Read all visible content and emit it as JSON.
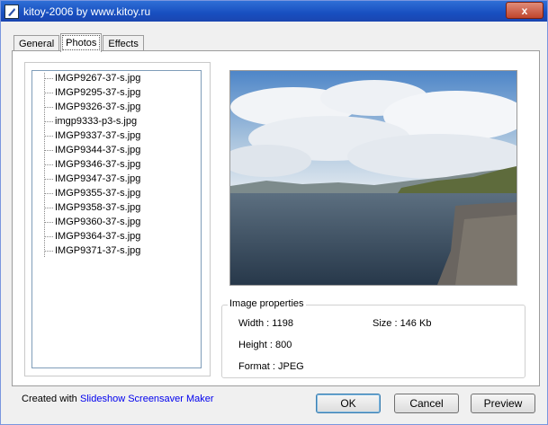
{
  "window": {
    "title": "kitoy-2006 by www.kitoy.ru",
    "close_glyph": "x"
  },
  "tabs": [
    {
      "label": "General"
    },
    {
      "label": "Photos"
    },
    {
      "label": "Effects"
    }
  ],
  "photo_list": [
    "IMGP9267-37-s.jpg",
    "IMGP9295-37-s.jpg",
    "IMGP9326-37-s.jpg",
    "imgp9333-p3-s.jpg",
    "IMGP9337-37-s.jpg",
    "IMGP9344-37-s.jpg",
    "IMGP9346-37-s.jpg",
    "IMGP9347-37-s.jpg",
    "IMGP9355-37-s.jpg",
    "IMGP9358-37-s.jpg",
    "IMGP9360-37-s.jpg",
    "IMGP9364-37-s.jpg",
    "IMGP9371-37-s.jpg"
  ],
  "image_properties": {
    "legend": "Image properties",
    "width": "Width : 1198",
    "height": "Height : 800",
    "size": "Size : 146 Kb",
    "format": "Format : JPEG"
  },
  "footer": {
    "created_with": "Created with",
    "link": "Slideshow Screensaver Maker"
  },
  "buttons": {
    "ok": "OK",
    "cancel": "Cancel",
    "preview": "Preview"
  }
}
